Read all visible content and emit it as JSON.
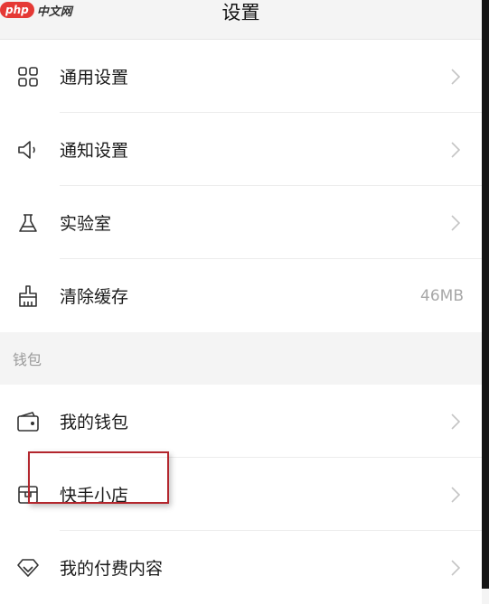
{
  "header": {
    "title": "设置",
    "watermark_badge": "php",
    "watermark_text": "中文网"
  },
  "general_items": [
    {
      "label": "通用设置",
      "icon": "grid-icon",
      "value": ""
    },
    {
      "label": "通知设置",
      "icon": "speaker-icon",
      "value": ""
    },
    {
      "label": "实验室",
      "icon": "flask-icon",
      "value": ""
    },
    {
      "label": "清除缓存",
      "icon": "broom-icon",
      "value": "46MB"
    }
  ],
  "wallet_section": {
    "title": "钱包",
    "items": [
      {
        "label": "我的钱包",
        "icon": "wallet-icon"
      },
      {
        "label": "快手小店",
        "icon": "store-icon"
      },
      {
        "label": "我的付费内容",
        "icon": "diamond-icon"
      }
    ]
  },
  "colors": {
    "highlight_border": "#b3262d",
    "background": "#f4f4f4"
  }
}
